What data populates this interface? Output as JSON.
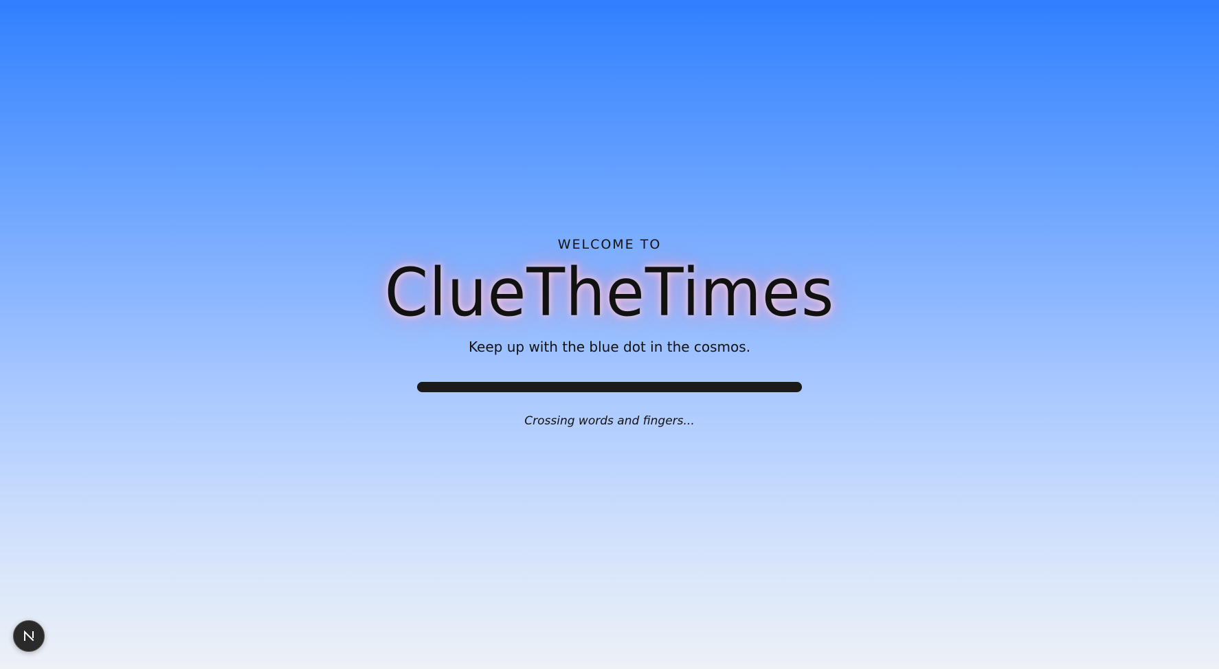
{
  "hero": {
    "welcome": "WELCOME TO",
    "title": "ClueTheTimes",
    "tagline": "Keep up with the blue dot in the cosmos."
  },
  "loader": {
    "progress": 1.0,
    "status": "Crossing words and fingers..."
  },
  "badge": {
    "letter": "N",
    "icon": "nextjs-logo-icon"
  },
  "colors": {
    "gradient_top": "#3080ff",
    "gradient_bottom": "#eef1f6",
    "progress_bar": "#1a1a1a",
    "title_glow": "#ff96b4"
  }
}
